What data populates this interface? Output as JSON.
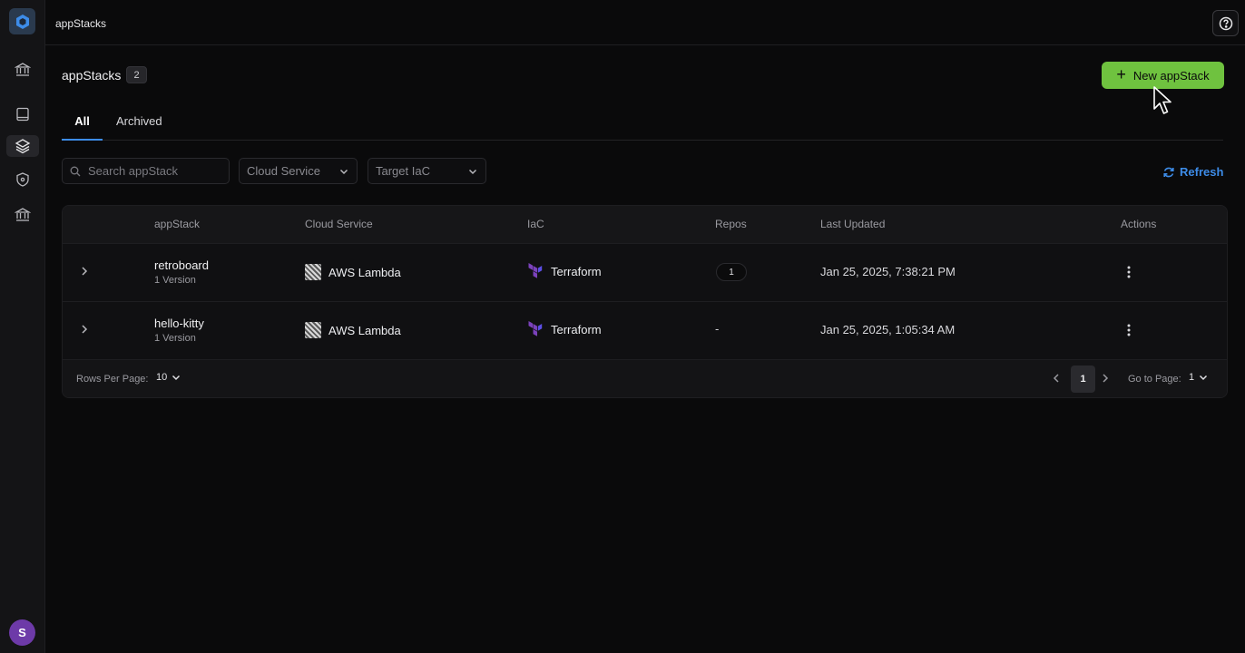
{
  "breadcrumb": "appStacks",
  "header": {
    "title": "appStacks",
    "count": "2",
    "new_button": "New appStack"
  },
  "tabs": [
    {
      "label": "All"
    },
    {
      "label": "Archived"
    }
  ],
  "filters": {
    "search_placeholder": "Search appStack",
    "cloud_service": "Cloud Service",
    "target_iac": "Target IaC",
    "refresh": "Refresh"
  },
  "table": {
    "headers": [
      "appStack",
      "Cloud Service",
      "IaC",
      "Repos",
      "Last Updated",
      "Actions"
    ],
    "rows": [
      {
        "name": "retroboard",
        "version": "1 Version",
        "cloud": "AWS Lambda",
        "iac": "Terraform",
        "repos": "1",
        "updated": "Jan 25, 2025, 7:38:21 PM"
      },
      {
        "name": "hello-kitty",
        "version": "1 Version",
        "cloud": "AWS Lambda",
        "iac": "Terraform",
        "repos": "-",
        "updated": "Jan 25, 2025, 1:05:34 AM"
      }
    ]
  },
  "pagination": {
    "rows_per_page_label": "Rows Per Page:",
    "rows_per_page": "10",
    "current_page": "1",
    "goto_label": "Go to Page:",
    "goto_value": "1"
  },
  "user": {
    "initial": "S"
  },
  "colors": {
    "accent_green": "#6fc23f",
    "accent_blue": "#3d8ce8",
    "avatar": "#6d3aa8",
    "terraform": "#7b42bc"
  },
  "icons": {
    "sidebar": [
      "bank-icon",
      "book-icon",
      "layers-icon",
      "shield-icon",
      "bank-icon"
    ],
    "misc": [
      "help-icon",
      "plus-icon",
      "search-icon",
      "chevron-down-icon",
      "refresh-icon",
      "chevron-right-icon",
      "kebab-icon",
      "aws-lambda-icon",
      "terraform-icon"
    ]
  }
}
